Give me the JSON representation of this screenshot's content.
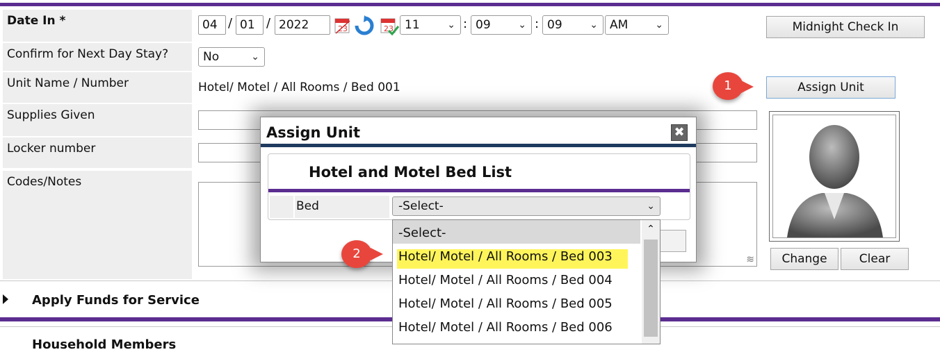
{
  "form": {
    "date_in_label": "Date In",
    "required_mark": "*",
    "date": {
      "month": "04",
      "day": "01",
      "year": "2022",
      "separator": "/"
    },
    "time": {
      "hour": "11",
      "minute": "09",
      "second": "09",
      "ampm": "AM",
      "separator": ":"
    },
    "midnight_button": "Midnight Check In",
    "confirm_label": "Confirm for Next Day Stay?",
    "confirm_value": "No",
    "unit_label": "Unit Name / Number",
    "unit_value": "Hotel/ Motel / All Rooms / Bed 001",
    "assign_button": "Assign Unit",
    "supplies_label": "Supplies Given",
    "locker_label": "Locker number",
    "codes_label": "Codes/Notes",
    "photo_change": "Change",
    "photo_clear": "Clear"
  },
  "sections": {
    "apply_funds": "Apply Funds for Service",
    "household": "Household Members"
  },
  "dialog": {
    "title": "Assign Unit",
    "subtitle": "Hotel and Motel Bed List",
    "bed_label": "Bed",
    "bed_select_value": "-Select-"
  },
  "dropdown": {
    "options": [
      "-Select-",
      "Hotel/ Motel / All Rooms / Bed 003",
      "Hotel/ Motel / All Rooms / Bed 004",
      "Hotel/ Motel / All Rooms / Bed 005",
      "Hotel/ Motel / All Rooms / Bed 006"
    ],
    "highlighted_index": 1
  },
  "callouts": {
    "one": "1",
    "two": "2"
  },
  "colors": {
    "accent": "#5b2d91",
    "dialog_rule": "#1f3a5f",
    "highlight": "#fff55a",
    "callout": "#e8463d"
  }
}
